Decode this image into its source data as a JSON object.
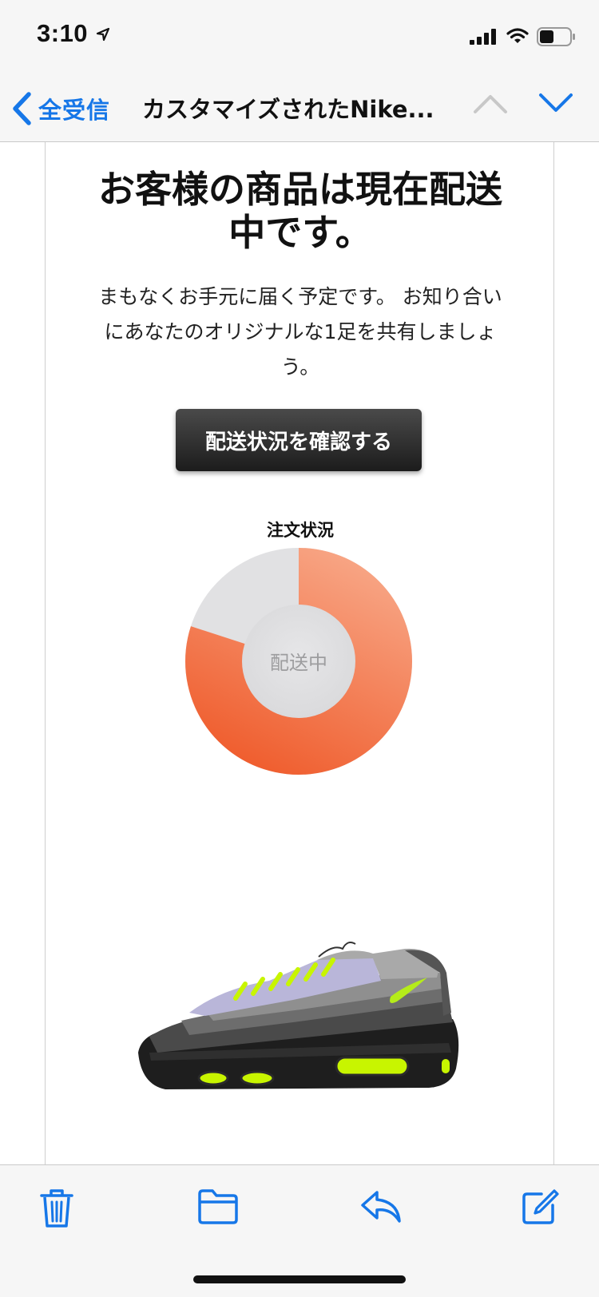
{
  "status_bar": {
    "time": "3:10",
    "icons": [
      "location-arrow-icon",
      "signal-icon",
      "wifi-icon",
      "battery-icon"
    ]
  },
  "nav": {
    "back_label": "全受信",
    "title": "カスタマイズされたNike...",
    "icons": [
      "chevron-left-icon",
      "chevron-up-icon",
      "chevron-down-icon"
    ]
  },
  "email": {
    "headline_line1": "お客様の商品は現在配送",
    "headline_line2": "中です。",
    "body_line1": "まもなくお手元に届く予定です。 お知り合い",
    "body_line2": "にあなたのオリジナルな1足を共有しましょ",
    "body_line3": "う。",
    "cta_label": "配送状況を確認する",
    "order_status_label": "注文状況",
    "donut_center_label": "配送中",
    "progress_fraction": 0.8,
    "product_image": "custom-nike-air-max-95-sneaker"
  },
  "toolbar": {
    "icons": [
      "trash-icon",
      "folder-icon",
      "reply-icon",
      "compose-icon"
    ]
  },
  "colors": {
    "accent_blue": "#1677e8",
    "progress_orange_dark": "#ef5a2a",
    "progress_orange_light": "#f8a888",
    "track_gray": "#e1e1e3",
    "button_dark": "#2a2a2a"
  }
}
